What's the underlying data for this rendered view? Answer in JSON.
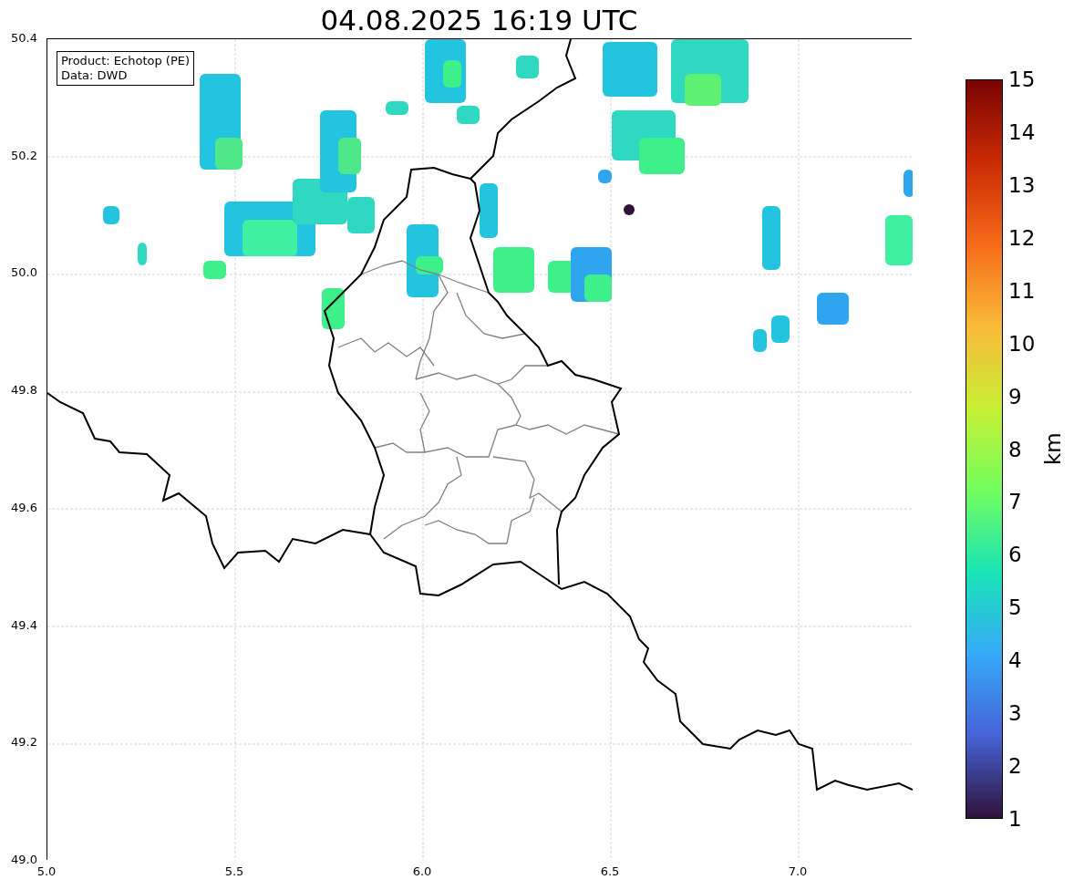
{
  "title": "04.08.2025 16:19 UTC",
  "legend": [
    "Product: Echotop (PE)",
    "Data: DWD"
  ],
  "y_ticks": [
    "50.4",
    "50.2",
    "50.0",
    "49.8",
    "49.6",
    "49.4",
    "49.2",
    "49.0"
  ],
  "x_ticks": [
    "5.0",
    "5.5",
    "6.0",
    "6.5",
    "7.0"
  ],
  "colorbar": {
    "label": "km",
    "ticks": [
      "15",
      "14",
      "13",
      "12",
      "11",
      "10",
      "9",
      "8",
      "7",
      "6",
      "5",
      "4",
      "3",
      "2",
      "1"
    ]
  }
}
